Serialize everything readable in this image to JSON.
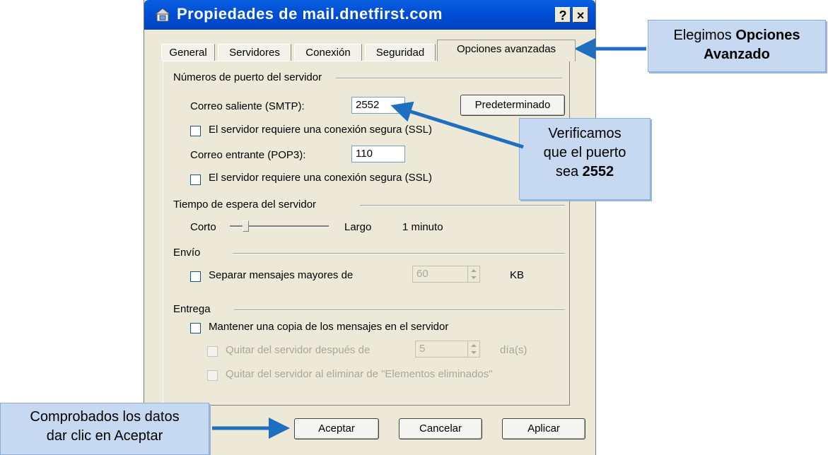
{
  "window": {
    "title": "Propiedades de mail.dnetfirst.com",
    "help_button": "?",
    "close_button": "×"
  },
  "tabs": [
    "General",
    "Servidores",
    "Conexión",
    "Seguridad",
    "Opciones avanzadas"
  ],
  "active_tab": "Opciones avanzadas",
  "ports": {
    "group_title": "Números de puerto del servidor",
    "smtp_label": "Correo saliente (SMTP):",
    "smtp_value": "2552",
    "default_button": "Predeterminado",
    "smtp_ssl_label": "El servidor requiere una conexión segura (SSL)",
    "pop3_label": "Correo entrante (POP3):",
    "pop3_value": "110",
    "pop3_ssl_label": "El servidor requiere una conexión segura (SSL)"
  },
  "timeout": {
    "group_title": "Tiempo de espera del servidor",
    "short_label": "Corto",
    "long_label": "Largo",
    "value_label": "1 minuto"
  },
  "sending": {
    "group_title": "Envío",
    "split_label": "Separar mensajes mayores de",
    "split_value": "60",
    "unit": "KB"
  },
  "delivery": {
    "group_title": "Entrega",
    "keep_copy_label": "Mantener una copia de los mensajes en el servidor",
    "remove_after_label": "Quitar del servidor después de",
    "remove_after_value": "5",
    "days_label": "día(s)",
    "remove_deleted_label": "Quitar del servidor al eliminar de \"Elementos eliminados\""
  },
  "buttons": {
    "ok": "Aceptar",
    "cancel": "Cancelar",
    "apply": "Aplicar"
  },
  "callouts": {
    "tab_text": "Elegimos",
    "tab_bold_1": "Opciones",
    "tab_bold_2": "Avanzado",
    "port_line1": "Verificamos",
    "port_line2": "que el puerto",
    "port_line3": "sea",
    "port_bold": "2552",
    "accept_line1": "Comprobados los datos",
    "accept_line2": "dar clic en Aceptar"
  },
  "colors": {
    "titlebar": "#0050d8",
    "dialog_bg": "#ece9d8",
    "callout_bg": "#c6d9f1",
    "arrow": "#1f6fc0"
  }
}
